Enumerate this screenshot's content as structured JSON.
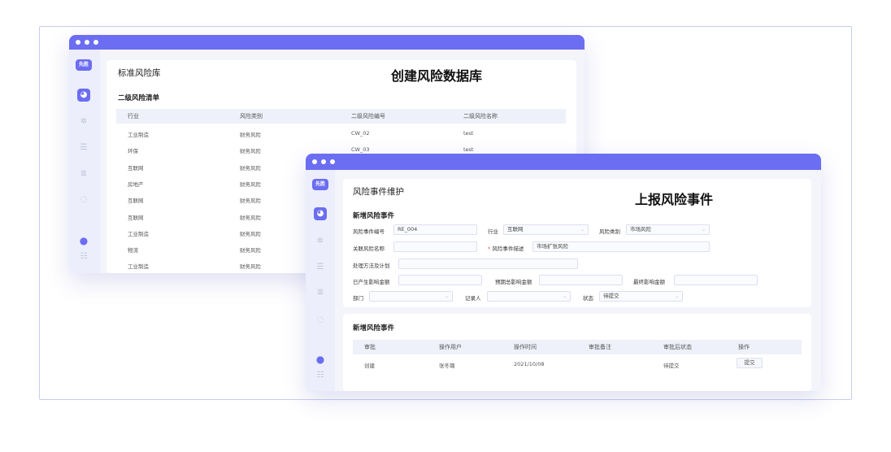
{
  "captions": {
    "window1": "创建风险数据库",
    "window2": "上报风险事件"
  },
  "sidebar": {
    "logo": "先胜"
  },
  "window1": {
    "title": "标准风险库",
    "section": "二级风险清单",
    "columns": [
      "行业",
      "风险类别",
      "二级风险编号",
      "二级风险名称"
    ],
    "rows": [
      [
        "工业制造",
        "财务风险",
        "CW_02",
        "test"
      ],
      [
        "环保",
        "财务风险",
        "CW_03",
        "test"
      ],
      [
        "互联网",
        "财务风险",
        "",
        ""
      ],
      [
        "房地产",
        "财务风险",
        "",
        ""
      ],
      [
        "互联网",
        "财务风险",
        "",
        ""
      ],
      [
        "互联网",
        "财务风险",
        "",
        ""
      ],
      [
        "工业制造",
        "财务风险",
        "",
        ""
      ],
      [
        "物流",
        "财务风险",
        "",
        ""
      ],
      [
        "工业制造",
        "财务风险",
        "",
        ""
      ]
    ]
  },
  "window2": {
    "title": "风险事件维护",
    "form_section": "新增风险事件",
    "form": {
      "event_no_label": "风险事件编号",
      "event_no_value": "RE_004",
      "industry_label": "行业",
      "industry_value": "互联网",
      "category_label": "风险类别",
      "category_value": "市场风险",
      "related_label": "关联风险名称",
      "related_value": "",
      "desc_required": "*",
      "desc_label": "风险事件描述",
      "desc_value": "市场扩张风险",
      "method_label": "处理方法及计划",
      "method_value": "",
      "loss_label": "已产生影响金额",
      "loss_value": "",
      "expected_label": "预期总影响金额",
      "expected_value": "",
      "final_label": "最终影响金额",
      "final_value": "",
      "dept_label": "部门",
      "dept_value": "",
      "recorder_label": "记录人",
      "recorder_value": "",
      "status_label": "状态",
      "status_value": "待提交"
    },
    "approval_section": "新增风险事件",
    "approval_columns": [
      "审批",
      "操作用户",
      "操作时间",
      "审批备注",
      "审批后状态",
      "操作"
    ],
    "approval_row": {
      "action": "创建",
      "user": "张冬璐",
      "time": "2021/10/08",
      "note": "",
      "status": "待提交",
      "button": "提交"
    }
  }
}
